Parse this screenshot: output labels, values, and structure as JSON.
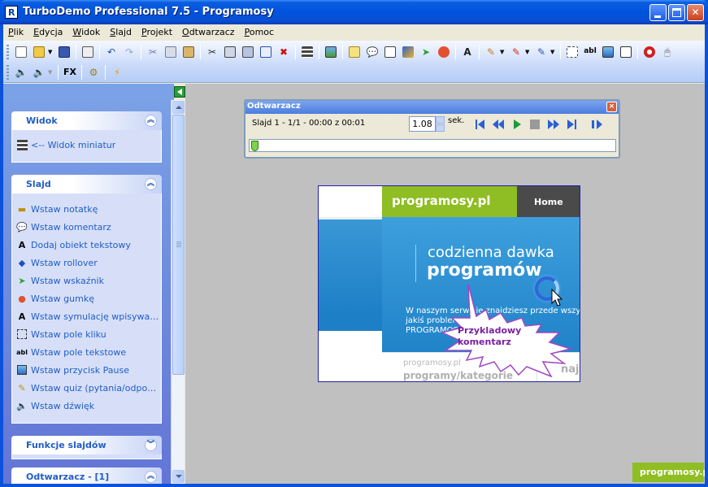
{
  "window": {
    "title": "TurboDemo Professional 7.5 - Programosy"
  },
  "menu": [
    "Plik",
    "Edycja",
    "Widok",
    "Slajd",
    "Projekt",
    "Odtwarzacz",
    "Pomoc"
  ],
  "toolbar": {
    "fx_label": "FX"
  },
  "sidebar": {
    "sections": [
      {
        "title": "Widok",
        "items": [
          {
            "label": "<-- Widok miniatur",
            "icon": "thumbnails-icon"
          }
        ]
      },
      {
        "title": "Slajd",
        "items": [
          {
            "label": "Wstaw notatkę",
            "icon": "note-icon"
          },
          {
            "label": "Wstaw komentarz",
            "icon": "comment-icon"
          },
          {
            "label": "Dodaj obiekt tekstowy",
            "icon": "text-object-icon"
          },
          {
            "label": "Wstaw rollover",
            "icon": "rollover-icon"
          },
          {
            "label": "Wstaw wskaźnik",
            "icon": "pointer-icon"
          },
          {
            "label": "Wstaw gumkę",
            "icon": "eraser-icon"
          },
          {
            "label": "Wstaw symulację wpisywania t...",
            "icon": "typing-simulation-icon"
          },
          {
            "label": "Wstaw pole kliku",
            "icon": "click-area-icon"
          },
          {
            "label": "Wstaw pole tekstowe",
            "icon": "textbox-icon"
          },
          {
            "label": "Wstaw przycisk Pause",
            "icon": "pause-button-icon"
          },
          {
            "label": "Wstaw quiz (pytania/odpowiedzi)",
            "icon": "quiz-icon"
          },
          {
            "label": "Wstaw dźwięk",
            "icon": "sound-icon"
          }
        ]
      },
      {
        "title": "Funkcje slajdów",
        "items": []
      },
      {
        "title": "Odtwarzacz - [1]",
        "items": []
      }
    ]
  },
  "player": {
    "title": "Odtwarzacz",
    "status": "Slajd 1 - 1/1 - 00:00 z 00:01",
    "speed": "1.08",
    "speed_unit": "sek."
  },
  "slide": {
    "brand": "programosy.pl",
    "nav_home": "Home",
    "headline_1": "codzienna dawka",
    "headline_2": "programów",
    "body_line_1": "W naszym serwisie znajdziesz przede wszyst",
    "body_line_2": "jakiś problem",
    "body_line_3": "PROGRAMOSY",
    "card_small": "programosy.pl",
    "card_title": "programy/kategorie",
    "card_right": "naj",
    "comment_line_1": "Przykladowy",
    "comment_line_2": "komentarz"
  },
  "footer_badge": "programosy.pl",
  "colors": {
    "brand_green": "#8fbd24",
    "xp_blue": "#0a52db",
    "comment_purple": "#7b1fa2"
  }
}
